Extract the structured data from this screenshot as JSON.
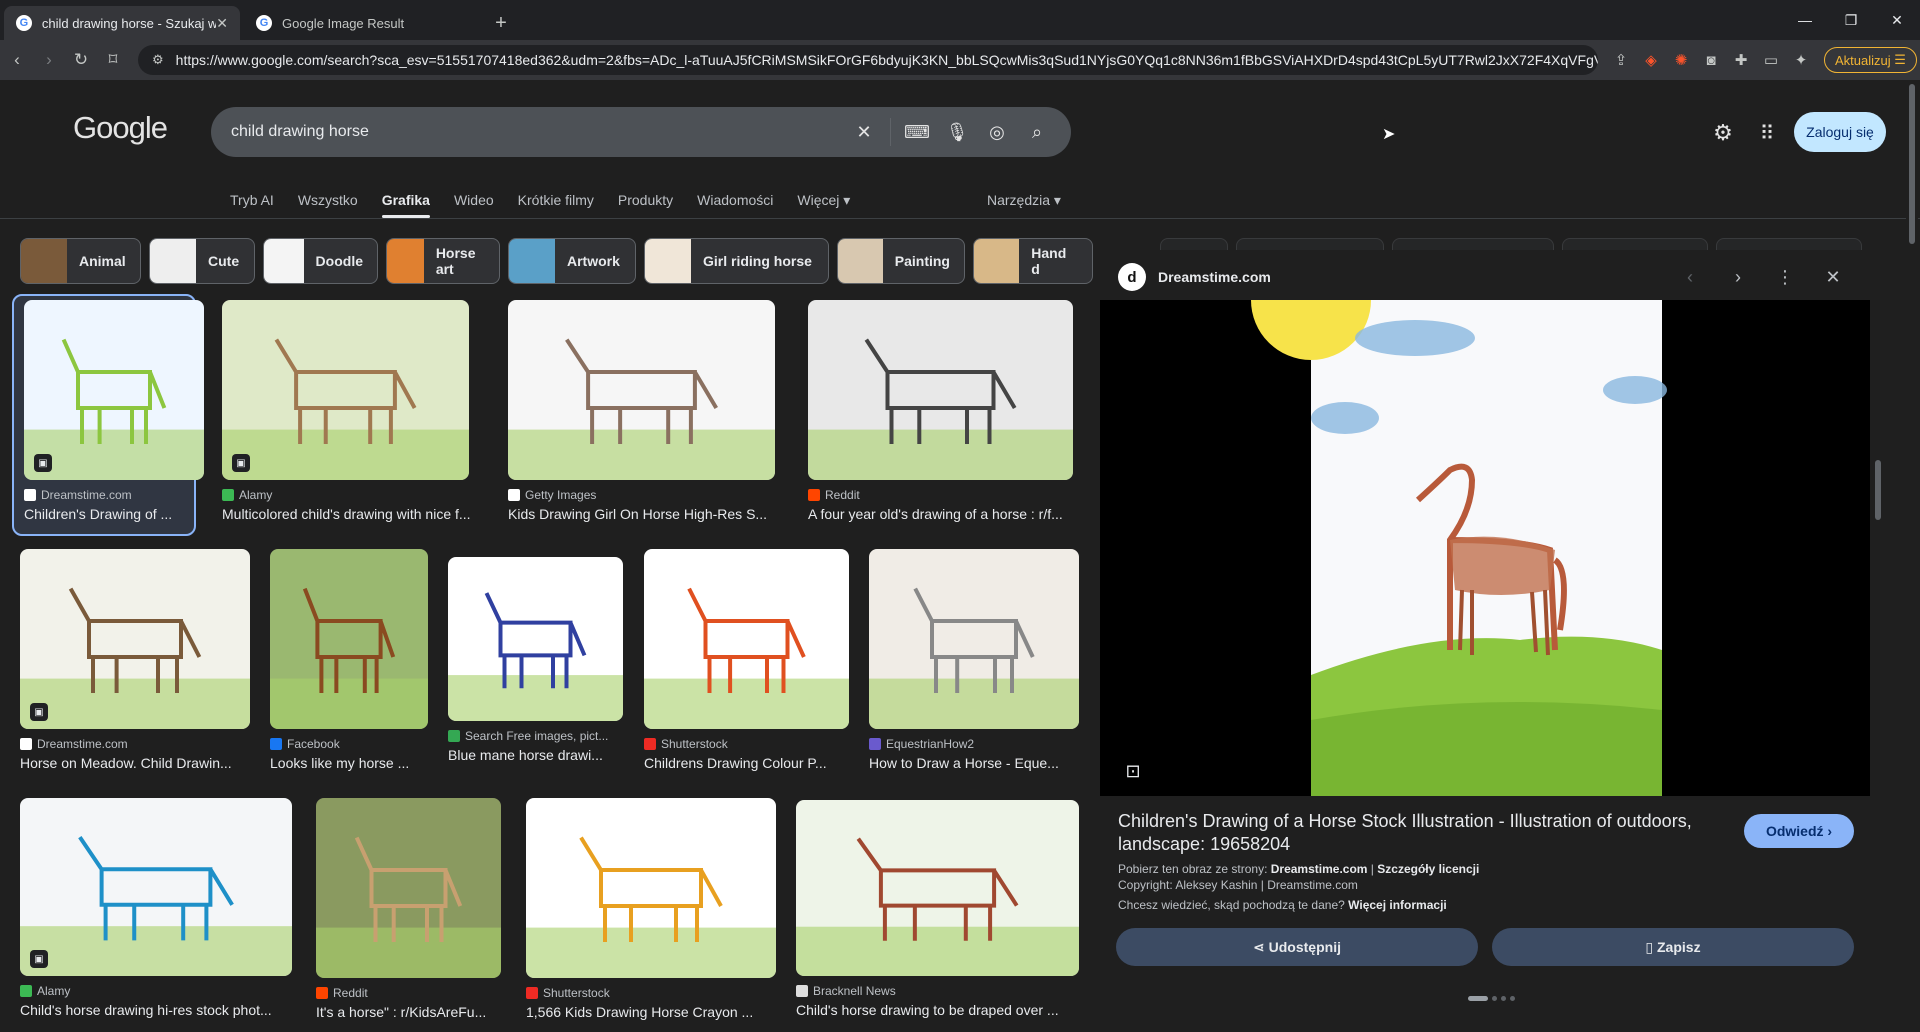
{
  "browser": {
    "tabs": [
      {
        "title": "child drawing horse - Szukaj w G",
        "active": true
      },
      {
        "title": "Google Image Result",
        "active": false
      }
    ],
    "url": "https://www.google.com/search?sca_esv=51551707418ed362&udm=2&fbs=ADc_l-aTuuAJ5fCRiMSMSikFOrGF6bdyujK3KN_bbLSQcwMis3qSud1NYjsG0YQq1c8NN36m1fBbGSViAHXDrD4spd43tCpL5yUT7Rwl2JxX72F4XqVFgV...",
    "update_label": "Aktualizuj"
  },
  "search": {
    "query": "child drawing horse",
    "signin_label": "Zaloguj się"
  },
  "nav_tabs": [
    "Tryb AI",
    "Wszystko",
    "Grafika",
    "Wideo",
    "Krótkie filmy",
    "Produkty",
    "Wiadomości",
    "Więcej ▾"
  ],
  "tools_label": "Narzędzia ▾",
  "chips": [
    {
      "label": "Animal",
      "color": "#7a5a3a"
    },
    {
      "label": "Cute",
      "color": "#eeeeee"
    },
    {
      "label": "Doodle",
      "color": "#f4f4f4"
    },
    {
      "label": "Horse art",
      "color": "#e08030"
    },
    {
      "label": "Artwork",
      "color": "#5aa0c8"
    },
    {
      "label": "Girl riding horse",
      "color": "#f0e6d8"
    },
    {
      "label": "Painting",
      "color": "#d8c8b0"
    },
    {
      "label": "Hand d",
      "color": "#d8b888"
    }
  ],
  "results": [
    {
      "source": "Dreamstime.com",
      "title": "Children's Drawing of ...",
      "icon_color": "#ffffff",
      "bg": "#eef6ff",
      "accent": "#8cc63f"
    },
    {
      "source": "Alamy",
      "title": "Multicolored child's drawing with nice f...",
      "icon_color": "#3cba54",
      "bg": "#dfe9c8",
      "accent": "#a07850"
    },
    {
      "source": "Getty Images",
      "title": "Kids Drawing Girl On Horse High-Res S...",
      "icon_color": "#ffffff",
      "bg": "#f6f6f6",
      "accent": "#8a7060"
    },
    {
      "source": "Reddit",
      "title": "A four year old's drawing of a horse : r/f...",
      "icon_color": "#ff4500",
      "bg": "#e8e8e8",
      "accent": "#444444"
    },
    {
      "source": "Dreamstime.com",
      "title": "Horse on Meadow. Child Drawin...",
      "icon_color": "#ffffff",
      "bg": "#f2f2ea",
      "accent": "#7a5a3a"
    },
    {
      "source": "Facebook",
      "title": "Looks like my horse ...",
      "icon_color": "#1877f2",
      "bg": "#9ab870",
      "accent": "#8a4a20"
    },
    {
      "source": "Search Free images, pict...",
      "title": "Blue mane horse drawi...",
      "icon_color": "#34a853",
      "bg": "#ffffff",
      "accent": "#3040a0"
    },
    {
      "source": "Shutterstock",
      "title": "Childrens Drawing Colour P...",
      "icon_color": "#ee2b24",
      "bg": "#ffffff",
      "accent": "#e05020"
    },
    {
      "source": "EquestrianHow2",
      "title": "How to Draw a Horse - Eque...",
      "icon_color": "#6a5acd",
      "bg": "#f0ece6",
      "accent": "#888888"
    },
    {
      "source": "Alamy",
      "title": "Child's horse drawing hi-res stock phot...",
      "icon_color": "#3cba54",
      "bg": "#f4f6f8",
      "accent": "#1e90c8"
    },
    {
      "source": "Reddit",
      "title": "It's a horse\" : r/KidsAreFu...",
      "icon_color": "#ff4500",
      "bg": "#8a9a60",
      "accent": "#c8a070"
    },
    {
      "source": "Shutterstock",
      "title": "1,566 Kids Drawing Horse Crayon ...",
      "icon_color": "#ee2b24",
      "bg": "#ffffff",
      "accent": "#e8a020"
    },
    {
      "source": "Bracknell News",
      "title": "Child's horse drawing to be draped over ...",
      "icon_color": "#dddddd",
      "bg": "#eef4e8",
      "accent": "#a04830"
    }
  ],
  "panel": {
    "source": "Dreamstime.com",
    "title": "Children's Drawing of a Horse Stock Illustration - Illustration of outdoors, landscape: 19658204",
    "visit_label": "Odwiedź ›",
    "from_prefix": "Pobierz ten obraz ze strony: ",
    "from_site": "Dreamstime.com",
    "from_sep": " | ",
    "license_label": "Szczegóły licencji",
    "copyright": "Copyright: Aleksey Kashin | Dreamstime.com",
    "where_prefix": "Chcesz wiedzieć, skąd pochodzą te dane? ",
    "where_link": "Więcej informacji",
    "share_label": "Udostępnij",
    "save_label": "Zapisz"
  }
}
